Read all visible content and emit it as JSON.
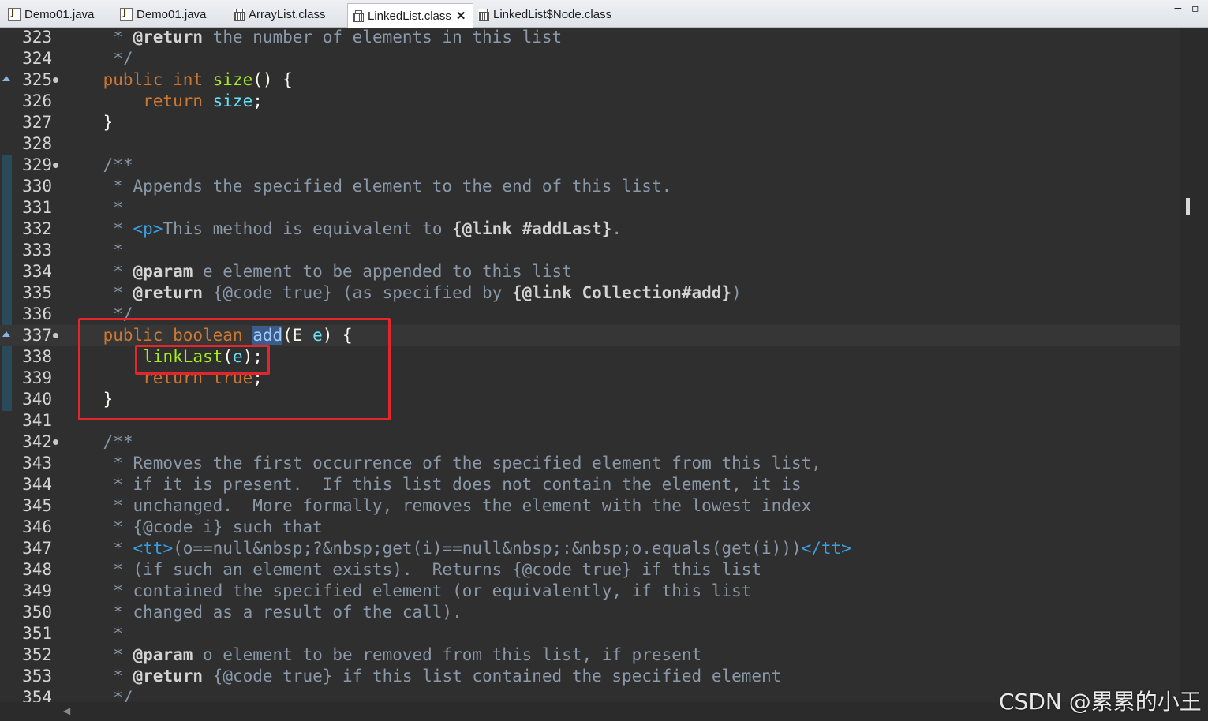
{
  "tabs": [
    {
      "label": "Demo01.java",
      "type": "java"
    },
    {
      "label": "Demo01.java",
      "type": "java"
    },
    {
      "label": "ArrayList.class",
      "type": "class"
    },
    {
      "label": "LinkedList.class",
      "type": "class",
      "active": true
    },
    {
      "label": "LinkedList$Node.class",
      "type": "class"
    }
  ],
  "window_controls": {
    "minimize": "−",
    "maximize": "▫"
  },
  "lines": [
    {
      "n": "323",
      "tokens": [
        [
          "doc",
          "     * "
        ],
        [
          "tag",
          "@return"
        ],
        [
          "doc",
          " the number of elements in this list"
        ]
      ]
    },
    {
      "n": "324",
      "tokens": [
        [
          "doc",
          "     */"
        ]
      ]
    },
    {
      "n": "325",
      "fold": true,
      "marker": true,
      "tokens": [
        [
          "kw",
          "    public int "
        ],
        [
          "meth",
          "size"
        ],
        [
          "txt",
          "() {"
        ]
      ]
    },
    {
      "n": "326",
      "tokens": [
        [
          "kw",
          "        return "
        ],
        [
          "fld",
          "size"
        ],
        [
          "txt",
          ";"
        ]
      ]
    },
    {
      "n": "327",
      "tokens": [
        [
          "txt",
          "    }"
        ]
      ]
    },
    {
      "n": "328",
      "tokens": []
    },
    {
      "n": "329",
      "fold": true,
      "tokens": [
        [
          "doc",
          "    /**"
        ]
      ]
    },
    {
      "n": "330",
      "tokens": [
        [
          "doc",
          "     * Appends the specified element to the end of this list."
        ]
      ]
    },
    {
      "n": "331",
      "tokens": [
        [
          "doc",
          "     *"
        ]
      ]
    },
    {
      "n": "332",
      "tokens": [
        [
          "doc",
          "     * "
        ],
        [
          "html",
          "<p>"
        ],
        [
          "doc",
          "This method is equivalent to "
        ],
        [
          "tag2",
          "{@link #addLast}"
        ],
        [
          "doc",
          "."
        ]
      ]
    },
    {
      "n": "333",
      "tokens": [
        [
          "doc",
          "     *"
        ]
      ]
    },
    {
      "n": "334",
      "tokens": [
        [
          "doc",
          "     * "
        ],
        [
          "tag",
          "@param"
        ],
        [
          "doc",
          " e element to be appended to this list"
        ]
      ]
    },
    {
      "n": "335",
      "tokens": [
        [
          "doc",
          "     * "
        ],
        [
          "tag",
          "@return"
        ],
        [
          "doc",
          " {@code true} (as specified by "
        ],
        [
          "tag2",
          "{@link Collection#add}"
        ],
        [
          "doc",
          ")"
        ]
      ]
    },
    {
      "n": "336",
      "tokens": [
        [
          "doc",
          "     */"
        ]
      ]
    },
    {
      "n": "337",
      "fold": true,
      "marker": true,
      "current": true,
      "tokens": [
        [
          "kw",
          "    public boolean "
        ],
        [
          "sel",
          "add"
        ],
        [
          "txt",
          "(E "
        ],
        [
          "fld",
          "e"
        ],
        [
          "txt",
          ") {"
        ]
      ]
    },
    {
      "n": "338",
      "tokens": [
        [
          "txt",
          "        "
        ],
        [
          "meth",
          "linkLast"
        ],
        [
          "txt",
          "("
        ],
        [
          "fld",
          "e"
        ],
        [
          "txt",
          ");"
        ]
      ]
    },
    {
      "n": "339",
      "tokens": [
        [
          "kw",
          "        return true"
        ],
        [
          "txt",
          ";"
        ]
      ]
    },
    {
      "n": "340",
      "tokens": [
        [
          "txt",
          "    }"
        ]
      ]
    },
    {
      "n": "341",
      "tokens": []
    },
    {
      "n": "342",
      "fold": true,
      "tokens": [
        [
          "doc",
          "    /**"
        ]
      ]
    },
    {
      "n": "343",
      "tokens": [
        [
          "doc",
          "     * Removes the first occurrence of the specified element from this list,"
        ]
      ]
    },
    {
      "n": "344",
      "tokens": [
        [
          "doc",
          "     * if it is present.  If this list does not contain the element, it is"
        ]
      ]
    },
    {
      "n": "345",
      "tokens": [
        [
          "doc",
          "     * unchanged.  More formally, removes the element with the lowest index"
        ]
      ]
    },
    {
      "n": "346",
      "tokens": [
        [
          "doc",
          "     * {@code i} such that"
        ]
      ]
    },
    {
      "n": "347",
      "tokens": [
        [
          "doc",
          "     * "
        ],
        [
          "html",
          "<tt>"
        ],
        [
          "doc",
          "(o==null&nbsp;?&nbsp;get(i)==null&nbsp;:&nbsp;o.equals(get(i)))"
        ],
        [
          "html",
          "</tt>"
        ]
      ]
    },
    {
      "n": "348",
      "tokens": [
        [
          "doc",
          "     * (if such an element exists).  Returns {@code true} if this list"
        ]
      ]
    },
    {
      "n": "349",
      "tokens": [
        [
          "doc",
          "     * contained the specified element (or equivalently, if this list"
        ]
      ]
    },
    {
      "n": "350",
      "tokens": [
        [
          "doc",
          "     * changed as a result of the call)."
        ]
      ]
    },
    {
      "n": "351",
      "tokens": [
        [
          "doc",
          "     *"
        ]
      ]
    },
    {
      "n": "352",
      "tokens": [
        [
          "doc",
          "     * "
        ],
        [
          "tag",
          "@param"
        ],
        [
          "doc",
          " o element to be removed from this list, if present"
        ]
      ]
    },
    {
      "n": "353",
      "tokens": [
        [
          "doc",
          "     * "
        ],
        [
          "tag",
          "@return"
        ],
        [
          "doc",
          " {@code true} if this list contained the specified element"
        ]
      ]
    },
    {
      "n": "354",
      "tokens": [
        [
          "doc",
          "     */"
        ]
      ]
    }
  ],
  "watermark": "CSDN @累累的小王"
}
